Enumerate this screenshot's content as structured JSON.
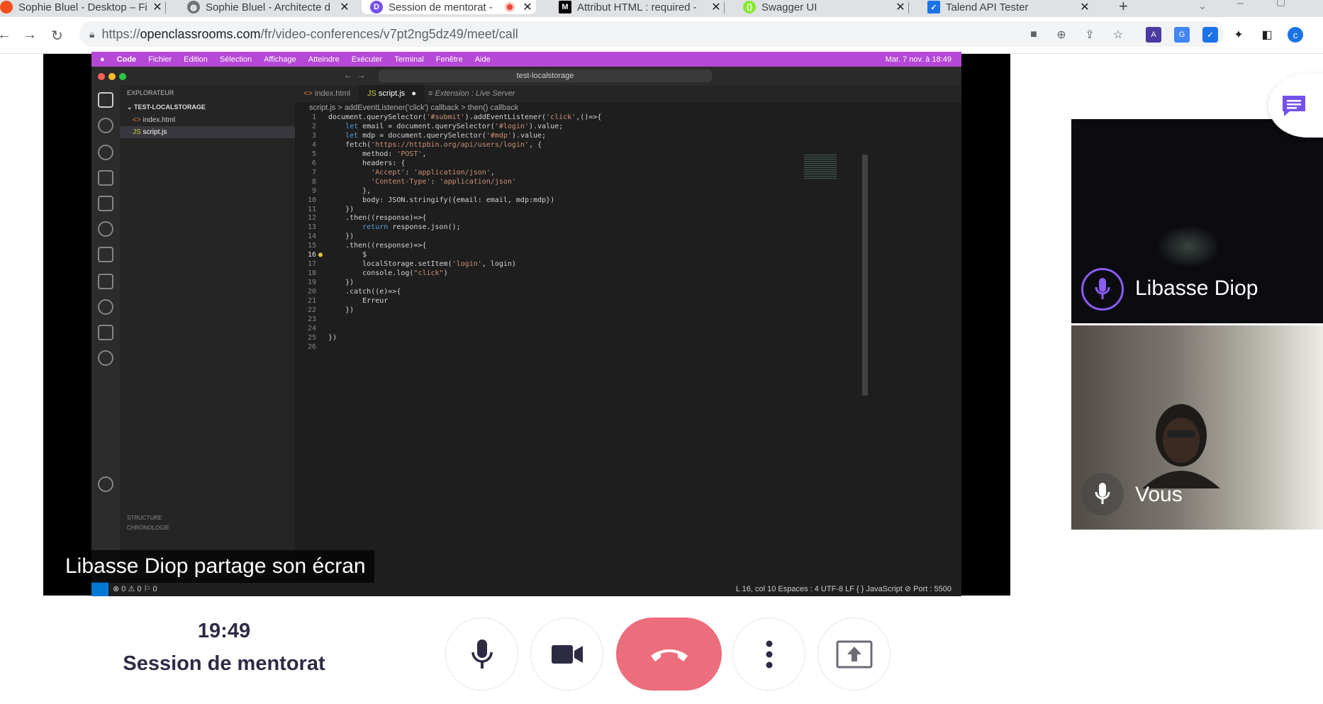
{
  "browser": {
    "tabs": [
      {
        "title": "Sophie Bluel - Desktop – Fi",
        "active": false,
        "icon": "figma-icon"
      },
      {
        "title": "Sophie Bluel - Architecte d",
        "active": false,
        "icon": "globe-icon"
      },
      {
        "title": "Session de mentorat -",
        "active": true,
        "icon": "openclassrooms-icon"
      },
      {
        "title": "Attribut HTML : required -",
        "active": false,
        "icon": "mdn-icon"
      },
      {
        "title": "Swagger UI",
        "active": false,
        "icon": "swagger-icon"
      },
      {
        "title": "Talend API Tester",
        "active": false,
        "icon": "talend-icon"
      }
    ],
    "url_prefix": "https://",
    "url_domain": "openclassrooms.com",
    "url_path": "/fr/video-conferences/v7pt2ng5dz49/meet/call",
    "profile_letter": "c"
  },
  "shared_screen": {
    "mac_menu": [
      "Code",
      "Fichier",
      "Edition",
      "Sélection",
      "Affichage",
      "Atteindre",
      "Exécuter",
      "Terminal",
      "Fenêtre",
      "Aide"
    ],
    "mac_clock": "Mar. 7 nov. à 18:49",
    "command_center": "test-localstorage",
    "explorer": {
      "header": "EXPLORATEUR",
      "folder": "TEST-LOCALSTORAGE",
      "files": [
        "index.html",
        "script.js"
      ],
      "bottom_items": [
        "STRUCTURE",
        "CHRONOLOGIE"
      ]
    },
    "editor_tabs": [
      "index.html",
      "script.js",
      "Extension : Live Server"
    ],
    "breadcrumb": "script.js > addEventListener('click') callback > then() callback",
    "code_lines": [
      "document.querySelector('#submit').addEventListener('click',()=>{",
      "    let email = document.querySelector('#login').value;",
      "    let mdp = document.querySelector('#mdp').value;",
      "    fetch('https://httpbin.org/api/users/login', {",
      "        method: 'POST',",
      "        headers: {",
      "          'Accept': 'application/json',",
      "          'Content-Type': 'application/json'",
      "        },",
      "        body: JSON.stringify({email: email, mdp:mdp})",
      "    })",
      "    .then((response)=>{",
      "        return response.json();",
      "    })",
      "    .then((response)=>{",
      "        $",
      "        localStorage.setItem('login', login)",
      "        console.log(\"click\")",
      "    })",
      "    .catch((e)=>{",
      "        Erreur",
      "    })",
      "",
      "",
      "})",
      ""
    ],
    "current_line": 16,
    "status_left": "⊗ 0 ⚠ 0   ⚐ 0",
    "status_right": "L 16, col 10    Espaces : 4    UTF-8    LF    { } JavaScript    ⊘ Port : 5500",
    "caption": "Libasse Diop partage son écran"
  },
  "participants": [
    {
      "name": "Libasse Diop"
    },
    {
      "name": "Vous"
    }
  ],
  "footer": {
    "time": "19:49",
    "session_title": "Session de mentorat"
  },
  "colors": {
    "accent_purple": "#7451eb",
    "hangup": "#ec6d7c",
    "vscode_bg": "#1e1e1e",
    "mac_menubar": "#b548d6"
  }
}
